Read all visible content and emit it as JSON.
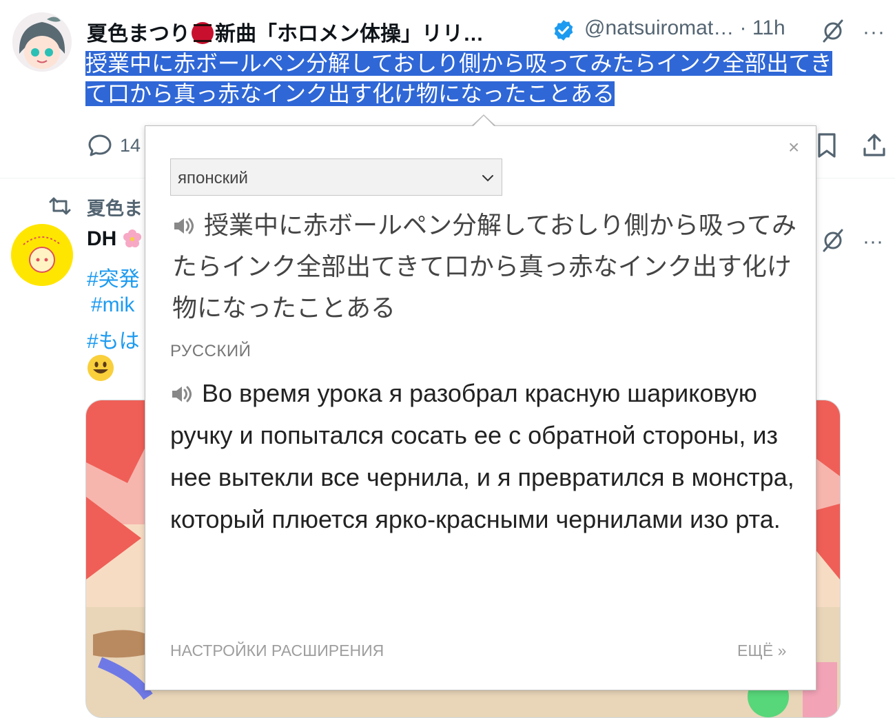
{
  "tweet1": {
    "display_name": "夏色まつり",
    "name_suffix": "新曲「ホロメン体操」リリ…",
    "handle": "@natsuiromat…",
    "time": "· 11h",
    "text_line1": "授業中に赤ボールペン分解しておしり側から吸ってみたらインク全部出てき",
    "text_line2": "て口から真っ赤なインク出す化け物になったことある",
    "reply_count": "14",
    "more_glyph": "···"
  },
  "tweet2": {
    "retweet_label": "夏色ま",
    "display_name": "DH",
    "hashtag1": "#突発",
    "hashtag2": "#mik",
    "hashtag3": "#もは",
    "more_glyph": "···"
  },
  "popup": {
    "close_glyph": "×",
    "source_language": "японский",
    "source_text": "授業中に赤ボールペン分解しておしり側から吸ってみたらインク全部出てきて口から真っ赤なインク出す化け物になったことある",
    "target_language": "РУССКИЙ",
    "translation": "Во время урока я разобрал красную шариковую ручку и попытался сосать ее с обратной стороны, из нее вытекли все чернила, и я превратился в монстра, который плюется ярко-красными чернилами изо рта.",
    "settings_link": "НАСТРОЙКИ РАСШИРЕНИЯ",
    "more_link": "ЕЩЁ »"
  },
  "colors": {
    "accent": "#1d9bf0",
    "selection": "#2f67d6",
    "muted": "#536471"
  },
  "icons": [
    "reply-icon",
    "bookmark-icon",
    "share-icon",
    "retweet-icon",
    "verified-badge-icon",
    "grok-icon",
    "speaker-icon",
    "chevron-down-icon",
    "close-icon"
  ]
}
